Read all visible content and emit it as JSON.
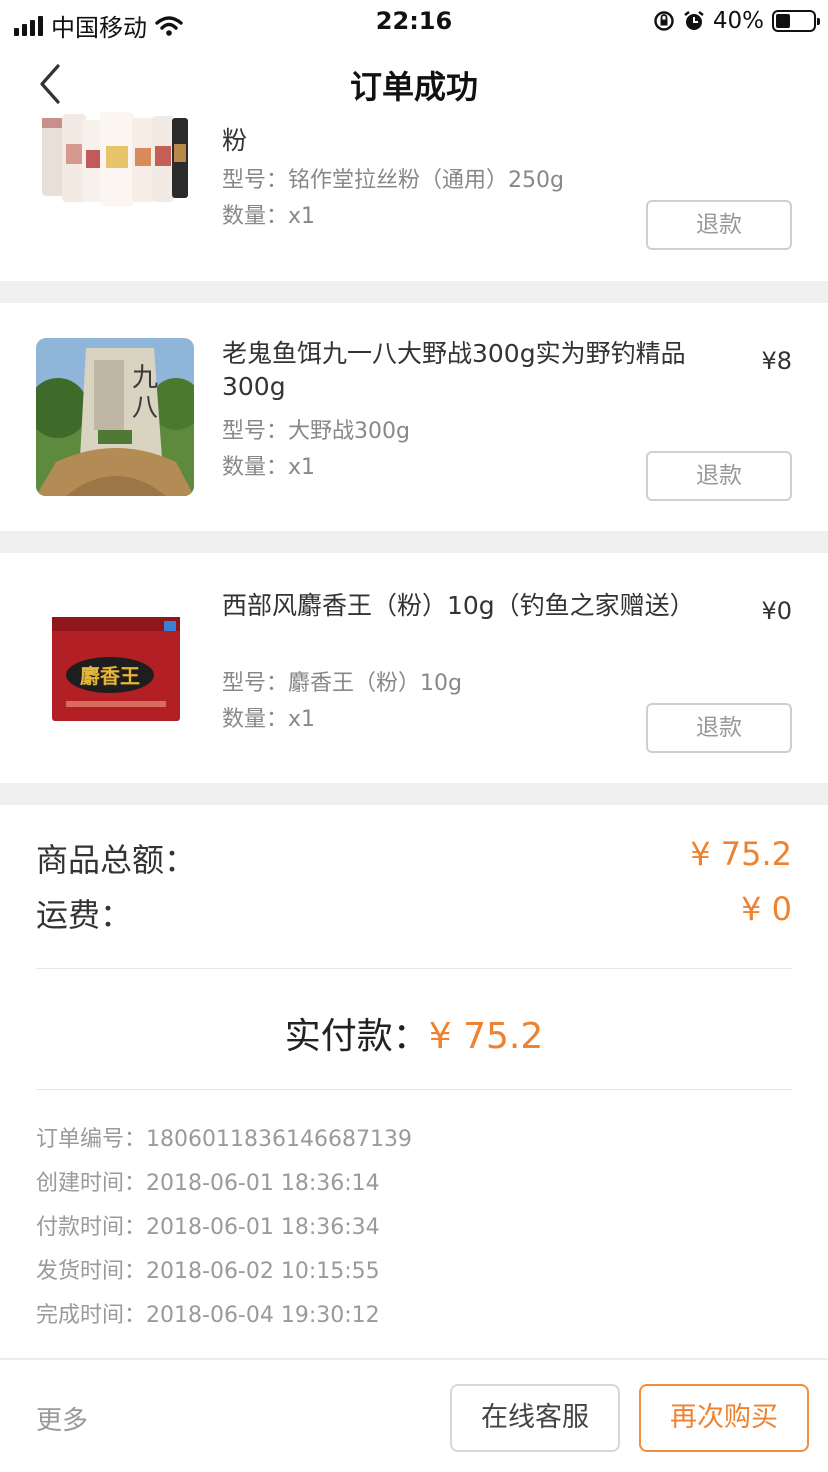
{
  "status_bar": {
    "carrier": "中国移动",
    "time": "22:16",
    "battery": "40%",
    "battery_level": 0.4,
    "icons": [
      "signal-icon",
      "wifi-icon",
      "orientation-lock-icon",
      "alarm-icon",
      "battery-icon"
    ]
  },
  "nav": {
    "title": "订单成功",
    "back_icon": "chevron-left-icon"
  },
  "items": [
    {
      "name": "粉",
      "spec": "型号：铭作堂拉丝粉（通用）250g",
      "qty": "数量：x1",
      "price": "",
      "refund": "退款"
    },
    {
      "name": "老鬼鱼饵九一八大野战300g实为野钓精品300g",
      "spec": "型号：大野战300g",
      "qty": "数量：x1",
      "price": "¥8",
      "refund": "退款"
    },
    {
      "name": "西部风麝香王（粉）10g（钓鱼之家赠送）",
      "spec": "型号：麝香王（粉）10g",
      "qty": "数量：x1",
      "price": "¥0",
      "refund": "退款"
    }
  ],
  "summary": {
    "goods_label": "商品总额：",
    "goods_value": "¥ 75.2",
    "shipping_label": "运费：",
    "shipping_value": "¥ 0",
    "paid_label": "实付款：",
    "paid_value": "¥ 75.2"
  },
  "order_info": {
    "order_no_label": "订单编号：",
    "order_no": "1806011836146687139",
    "created_label": "创建时间：",
    "created": "2018-06-01 18:36:14",
    "paid_label": "付款时间：",
    "paid": "2018-06-01 18:36:34",
    "shipped_label": "发货时间：",
    "shipped": "2018-06-02 10:15:55",
    "completed_label": "完成时间：",
    "completed": "2018-06-04 19:30:12"
  },
  "bottom": {
    "more": "更多",
    "customer_service": "在线客服",
    "buy_again": "再次购买"
  },
  "colors": {
    "accent": "#ef8230",
    "divider": "#f0f0f0"
  }
}
